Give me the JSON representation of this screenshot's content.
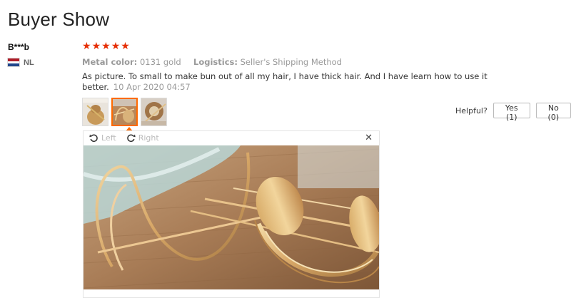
{
  "header": {
    "title": "Buyer Show"
  },
  "reviewer": {
    "name": "B***b",
    "country_code": "NL",
    "flag_colors": [
      "#ae1c28",
      "#ffffff",
      "#21468b"
    ]
  },
  "review": {
    "rating": 5,
    "rating_max": 5,
    "star_icon": "★",
    "star_color": "#e62e04",
    "metal_color_label": "Metal color:",
    "metal_color_value": "0131 gold",
    "logistics_label": "Logistics:",
    "logistics_value": "Seller's Shipping Method",
    "text": "As picture. To small to make bun out of all my hair, I have thick hair. And I have learn how to use it better.",
    "date": "10 Apr 2020 04:57"
  },
  "thumbnails": [
    {
      "icon": "photo-thumbnail-1",
      "selected": false
    },
    {
      "icon": "photo-thumbnail-2",
      "selected": true
    },
    {
      "icon": "photo-thumbnail-3",
      "selected": false
    }
  ],
  "helpful": {
    "label": "Helpful?",
    "yes_label": "Yes (1)",
    "no_label": "No (0)"
  },
  "viewer": {
    "rotate_left_label": "Left",
    "rotate_right_label": "Right",
    "rotate_left_icon": "rotate-left-icon",
    "rotate_right_icon": "rotate-right-icon",
    "close_icon": "close-icon",
    "close_glyph": "✕"
  },
  "colors": {
    "accent": "#ff6a00",
    "star": "#e62e04"
  }
}
